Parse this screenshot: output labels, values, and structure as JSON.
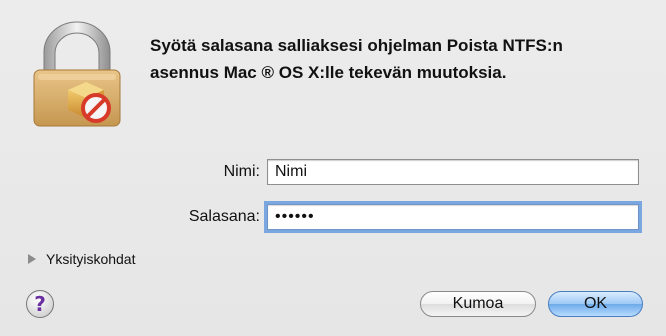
{
  "dialog": {
    "message": "Syötä salasana salliaksesi ohjelman Poista NTFS:n asennus Mac ® OS X:lle tekevän muutoksia.",
    "icon": "lock-with-package-icon"
  },
  "fields": {
    "name_label": "Nimi:",
    "name_value": "Nimi",
    "password_label": "Salasana:",
    "password_value": "••••••"
  },
  "details": {
    "label": "Yksityiskohdat"
  },
  "buttons": {
    "help_label": "?",
    "cancel_label": "Kumoa",
    "ok_label": "OK"
  },
  "colors": {
    "focus_ring": "#7aa7e0",
    "default_button": "#6eaaea",
    "badge_red": "#d83a2a"
  }
}
